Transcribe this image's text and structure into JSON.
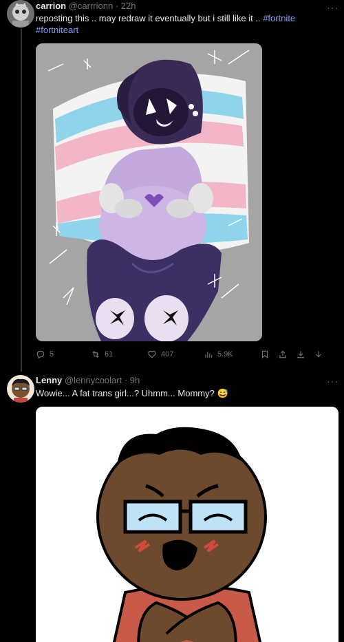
{
  "post1": {
    "name": "carrion",
    "handle": "@carrrionn",
    "time": "22h",
    "text_main": "reposting this .. may redraw it eventually but i still like it .. ",
    "hashtag1": "#fortnite",
    "hashtag2": "#fortniteart",
    "replies": "5",
    "reposts": "61",
    "likes": "407",
    "views": "5.9K",
    "more": "···"
  },
  "post2": {
    "name": "Lenny",
    "handle": "@lennycoolart",
    "time": "9h",
    "text": "Wowie... A fat trans girl...? Uhmm... Mommy? 😅",
    "more": "···"
  },
  "colors": {
    "background": "#000000",
    "text": "#e7e9ea",
    "muted": "#71767b",
    "hashtag": "#8b98f5",
    "thread_line": "#333639"
  },
  "icons": [
    "reply-icon",
    "repost-icon",
    "like-icon",
    "views-icon",
    "bookmark-icon",
    "share-icon",
    "download-icon"
  ]
}
